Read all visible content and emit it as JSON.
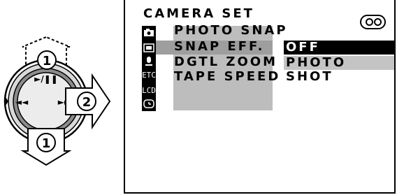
{
  "controller": {
    "play_pause_label": "►/❚❚",
    "rewind_label": "◄◄",
    "forward_label": "►►",
    "callout_up": "1",
    "callout_right": "2",
    "callout_down": "1"
  },
  "osd": {
    "title": "CAMERA SET",
    "icons": [
      "camera-icon",
      "photo-icon",
      "microphone-icon",
      "etc-icon",
      "lcd-icon",
      "clock-icon"
    ],
    "icon_labels": {
      "etc": "ETC",
      "lcd": "LCD"
    },
    "menu_items": [
      {
        "label": "PHOTO SNAP"
      },
      {
        "label": "SNAP EFF."
      },
      {
        "label": "DGTL ZOOM"
      },
      {
        "label": "TAPE SPEED"
      }
    ],
    "options": [
      {
        "label": "OFF",
        "selected": true
      },
      {
        "label": "PHOTO SHOT",
        "selected": false
      }
    ],
    "status_icon": "tape-cassette-icon"
  },
  "colors": {
    "selected_bg": "#000000",
    "menu_panel_bg": "#bdbdbd",
    "highlight_row_bg": "#9e9e9e",
    "option_bg": "#c4c4c4"
  }
}
